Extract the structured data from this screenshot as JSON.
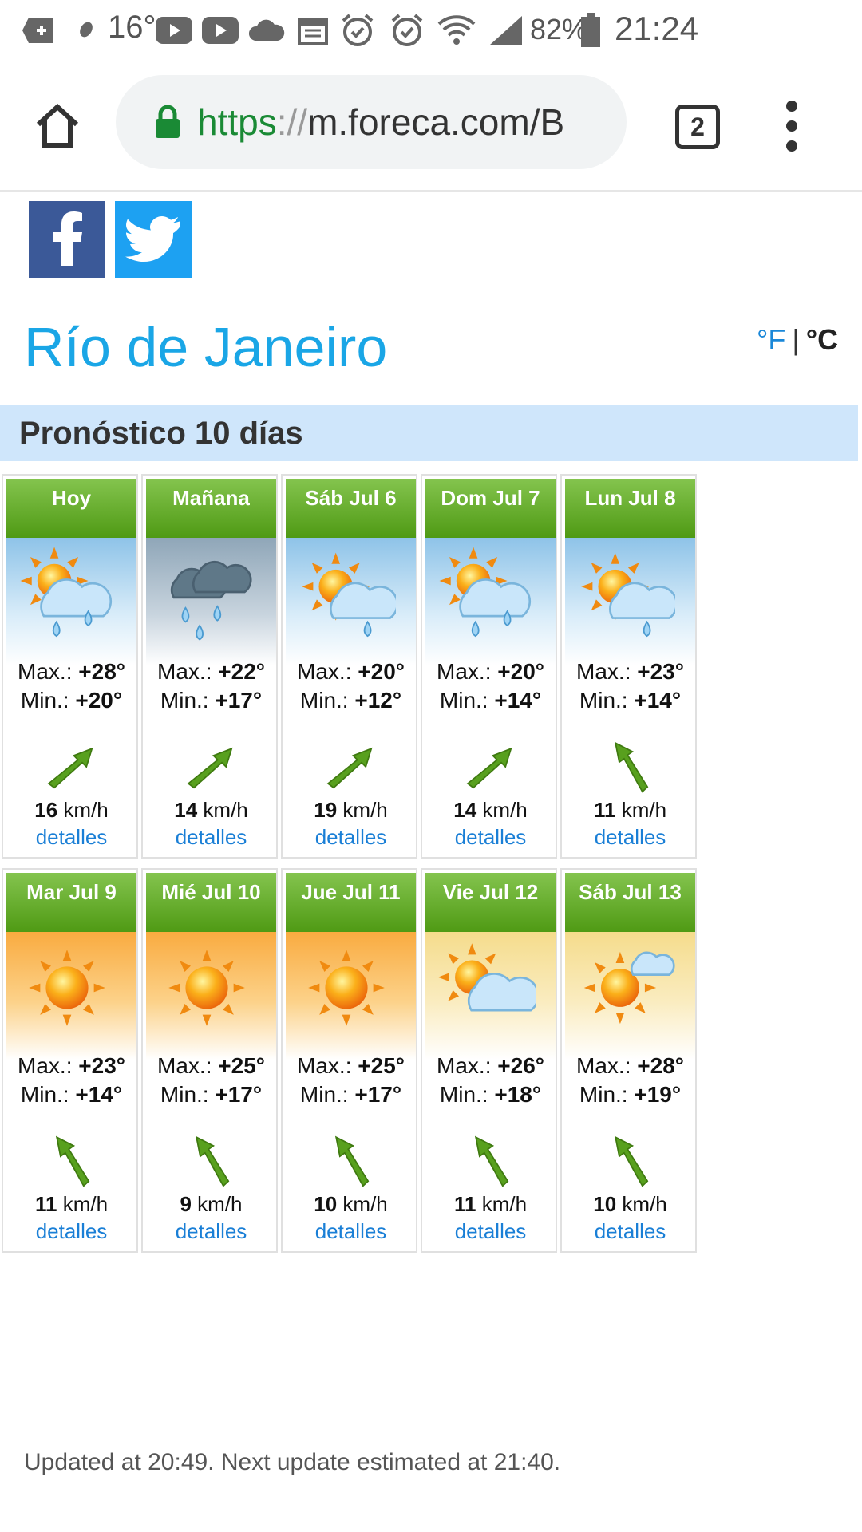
{
  "status_bar": {
    "temperature": "16°",
    "battery": "82%",
    "time": "21:24"
  },
  "browser": {
    "url_scheme": "https",
    "url_sep": "://",
    "url_host": "m.foreca.com/B",
    "tab_count": "2"
  },
  "page": {
    "city": "Río de Janeiro",
    "unit_f": "°F",
    "unit_sep": "|",
    "unit_c": "°C",
    "section_title": "Pronóstico 10 días",
    "max_label": "Max.:",
    "min_label": "Min.:",
    "speed_unit": "km/h",
    "details_label": "detalles",
    "footer": "Updated at 20:49. Next update estimated at 21:40."
  },
  "days": [
    {
      "label": "Hoy",
      "max": "+28°",
      "min": "+20°",
      "wind": "16",
      "icon": "sun-cloud-rain-icon",
      "sky": "blue",
      "wind_dir": "northeast"
    },
    {
      "label": "Mañana",
      "max": "+22°",
      "min": "+17°",
      "wind": "14",
      "icon": "dark-cloud-rain-icon",
      "sky": "grey",
      "wind_dir": "northeast"
    },
    {
      "label": "Sáb Jul 6",
      "max": "+20°",
      "min": "+12°",
      "wind": "19",
      "icon": "sun-cloud-light-rain-icon",
      "sky": "blue",
      "wind_dir": "northeast"
    },
    {
      "label": "Dom Jul 7",
      "max": "+20°",
      "min": "+14°",
      "wind": "14",
      "icon": "sun-cloud-rain-icon",
      "sky": "blue",
      "wind_dir": "northeast"
    },
    {
      "label": "Lun Jul 8",
      "max": "+23°",
      "min": "+14°",
      "wind": "11",
      "icon": "sun-cloud-light-rain-icon",
      "sky": "blue",
      "wind_dir": "northwest"
    },
    {
      "label": "Mar Jul 9",
      "max": "+23°",
      "min": "+14°",
      "wind": "11",
      "icon": "sun-icon",
      "sky": "orange",
      "wind_dir": "northwest"
    },
    {
      "label": "Mié Jul 10",
      "max": "+25°",
      "min": "+17°",
      "wind": "9",
      "icon": "sun-icon",
      "sky": "orange",
      "wind_dir": "northwest"
    },
    {
      "label": "Jue Jul 11",
      "max": "+25°",
      "min": "+17°",
      "wind": "10",
      "icon": "sun-icon",
      "sky": "orange",
      "wind_dir": "northwest"
    },
    {
      "label": "Vie Jul 12",
      "max": "+26°",
      "min": "+18°",
      "wind": "11",
      "icon": "sun-big-cloud-icon",
      "sky": "yellow",
      "wind_dir": "northwest"
    },
    {
      "label": "Sáb Jul 13",
      "max": "+28°",
      "min": "+19°",
      "wind": "10",
      "icon": "sun-small-cloud-icon",
      "sky": "yellow",
      "wind_dir": "northwest"
    }
  ],
  "colors": {
    "city_title": "#1aa6e6",
    "header_green": "#4f9a14",
    "section_bg": "#cfe6fb",
    "link": "#1a7fd6",
    "facebook": "#3b5998",
    "twitter": "#1da1f2"
  }
}
